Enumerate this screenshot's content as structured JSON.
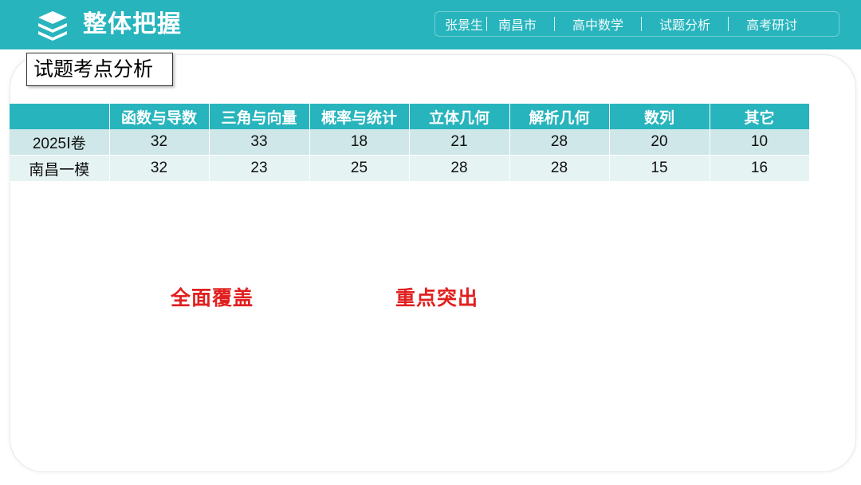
{
  "header": {
    "title": "整体把握",
    "nav": [
      "张景生",
      "南昌市",
      "高中数学",
      "试题分析",
      "高考研讨"
    ],
    "logo_icon": "layers-icon",
    "color": "#27b4bd"
  },
  "section": {
    "label": "试题考点分析"
  },
  "table": {
    "columns": [
      "",
      "函数与导数",
      "三角与向量",
      "概率与统计",
      "立体几何",
      "解析几何",
      "数列",
      "其它"
    ],
    "rows": [
      {
        "label": "2025Ⅰ卷",
        "values": [
          "32",
          "33",
          "18",
          "21",
          "28",
          "20",
          "10"
        ]
      },
      {
        "label": "南昌一模",
        "values": [
          "32",
          "23",
          "25",
          "28",
          "28",
          "15",
          "16"
        ]
      }
    ]
  },
  "highlights": [
    "全面覆盖",
    "重点突出"
  ],
  "highlight_color": "#e0201f"
}
